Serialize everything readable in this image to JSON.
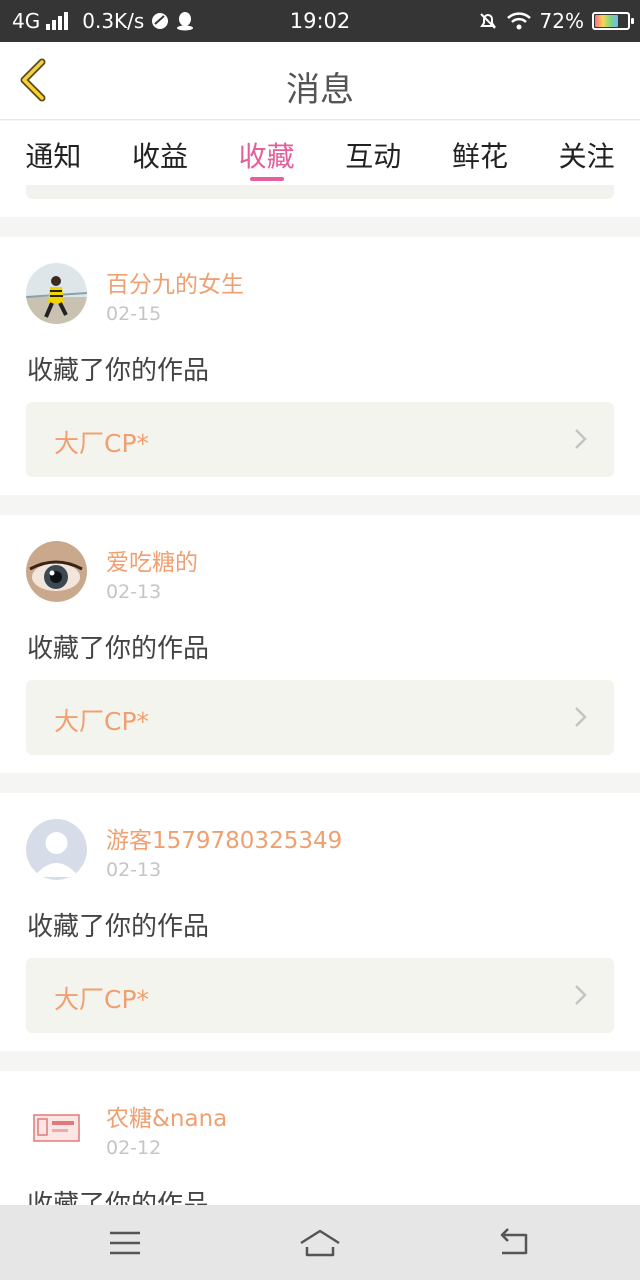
{
  "status_bar": {
    "network": "4G",
    "speed": "0.3K/s",
    "time": "19:02",
    "battery": "72%",
    "battery_level": 0.72
  },
  "header": {
    "title": "消息"
  },
  "tabs": [
    {
      "label": "通知",
      "active": false
    },
    {
      "label": "收益",
      "active": false
    },
    {
      "label": "收藏",
      "active": true
    },
    {
      "label": "互动",
      "active": false
    },
    {
      "label": "鲜花",
      "active": false
    },
    {
      "label": "关注",
      "active": false
    }
  ],
  "accent_color": "#e55f9c",
  "name_color": "#f0a070",
  "notifications": [
    {
      "user": "百分九的女生",
      "date": "02-15",
      "action": "收藏了你的作品",
      "work": "大厂CP*"
    },
    {
      "user": "爱吃糖的",
      "date": "02-13",
      "action": "收藏了你的作品",
      "work": "大厂CP*"
    },
    {
      "user": "游客1579780325349",
      "date": "02-13",
      "action": "收藏了你的作品",
      "work": "大厂CP*"
    },
    {
      "user": "农糖&nana",
      "date": "02-12",
      "action": "收藏了你的作品",
      "work": ""
    }
  ],
  "bottom_nav": {
    "items": [
      "menu-icon",
      "home-icon",
      "back-icon"
    ]
  }
}
